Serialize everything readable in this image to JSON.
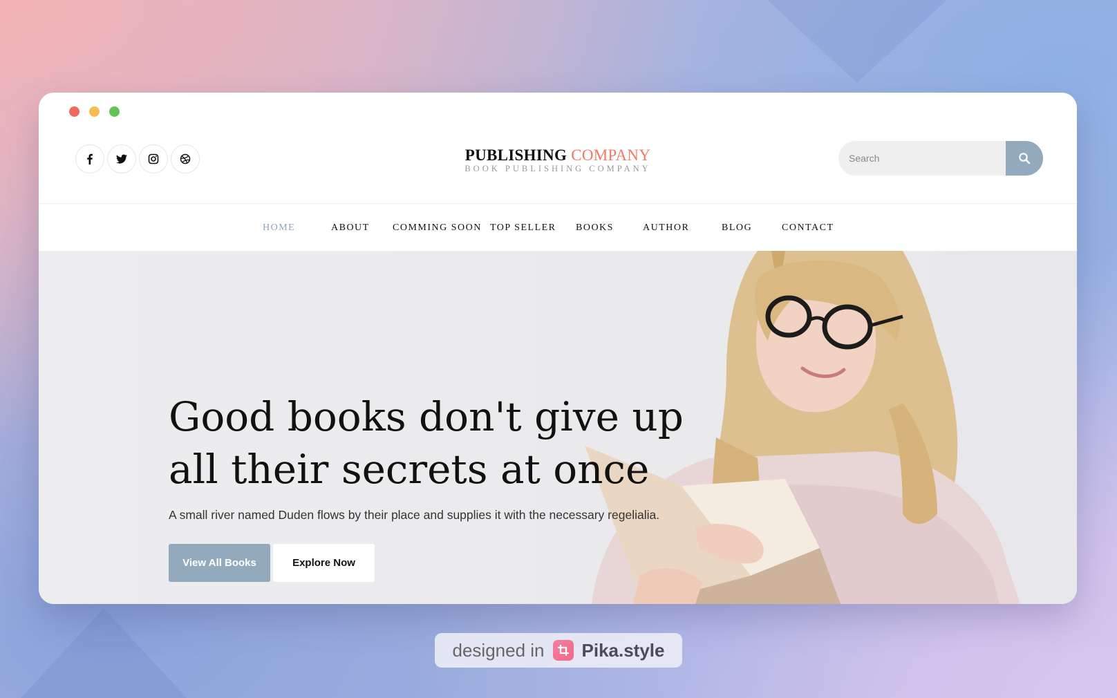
{
  "window_controls": [
    "close",
    "minimize",
    "maximize"
  ],
  "header": {
    "social": [
      {
        "icon": "facebook-icon",
        "glyph": "f"
      },
      {
        "icon": "twitter-icon",
        "glyph": "t"
      },
      {
        "icon": "instagram-icon",
        "glyph": "ig"
      },
      {
        "icon": "dribbble-icon",
        "glyph": "d"
      }
    ],
    "logo": {
      "primary": "PUBLISHING",
      "accent": "COMPANY",
      "tagline": "BOOK PUBLISHING COMPANY"
    },
    "search": {
      "placeholder": "Search",
      "value": "",
      "button_icon": "search-icon"
    }
  },
  "nav": {
    "items": [
      {
        "label": "HOME",
        "active": true
      },
      {
        "label": "ABOUT",
        "active": false
      },
      {
        "label": "COMMING SOON",
        "active": false
      },
      {
        "label": "TOP SELLER",
        "active": false
      },
      {
        "label": "BOOKS",
        "active": false
      },
      {
        "label": "AUTHOR",
        "active": false
      },
      {
        "label": "BLOG",
        "active": false
      },
      {
        "label": "CONTACT",
        "active": false
      }
    ]
  },
  "hero": {
    "title_line1": "Good books don't give up",
    "title_line2": "all their secrets at once",
    "subtitle": "A small river named Duden flows by their place and supplies it with the necessary regelialia.",
    "primary_button": "View All Books",
    "secondary_button": "Explore Now"
  },
  "badge": {
    "prefix": "designed in",
    "brand": "Pika.style"
  },
  "colors": {
    "accent": "#f07a63",
    "button": "#93aabd",
    "nav_active": "#8fa5b9"
  }
}
